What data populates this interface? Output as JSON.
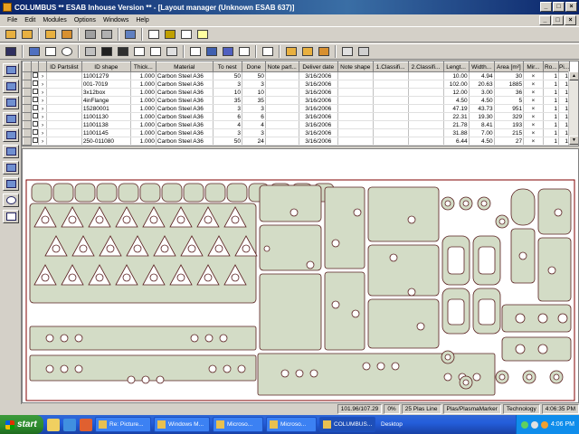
{
  "window": {
    "title": "COLUMBUS ** ESAB Inhouse Version ** - [Layout manager (Unknown ESAB 637)]",
    "min": "_",
    "max": "□",
    "close": "×"
  },
  "menu": [
    "File",
    "Edit",
    "Modules",
    "Options",
    "Windows",
    "Help"
  ],
  "grid": {
    "columns": [
      "ID Partslist",
      "ID shape",
      "Thick...",
      "Material",
      "To nest",
      "Done",
      "Note part...",
      "Deliver date",
      "Note shape",
      "1.Classifi...",
      "2.Classifi...",
      "Lengt...",
      "Width...",
      "Area [m²]",
      "Mir...",
      "Ro...",
      "Pi..."
    ],
    "rows": [
      [
        "11001279",
        "1.000",
        "Carbon Steel A36",
        "50",
        "50",
        "3/16/2006",
        "10.00",
        "4.94",
        "30",
        "×",
        "1",
        "1"
      ],
      [
        "001-7019",
        "1.000",
        "Carbon Steel A36",
        "3",
        "3",
        "3/16/2006",
        "102.00",
        "20.63",
        "1885",
        "×",
        "1",
        "1"
      ],
      [
        "3x12box",
        "1.000",
        "Carbon Steel A36",
        "10",
        "10",
        "3/16/2006",
        "12.00",
        "3.00",
        "36",
        "×",
        "1",
        "1"
      ],
      [
        "4inFlange",
        "1.000",
        "Carbon Steel A36",
        "35",
        "35",
        "3/16/2006",
        "4.50",
        "4.50",
        "5",
        "×",
        "1",
        "1"
      ],
      [
        "15280001",
        "1.000",
        "Carbon Steel A36",
        "3",
        "3",
        "3/16/2006",
        "47.19",
        "43.73",
        "951",
        "×",
        "1",
        "1"
      ],
      [
        "11001130",
        "1.000",
        "Carbon Steel A36",
        "6",
        "6",
        "3/16/2006",
        "22.31",
        "19.30",
        "329",
        "×",
        "1",
        "1"
      ],
      [
        "11001138",
        "1.000",
        "Carbon Steel A36",
        "4",
        "4",
        "3/16/2006",
        "21.78",
        "8.41",
        "193",
        "×",
        "1",
        "1"
      ],
      [
        "11001145",
        "1.000",
        "Carbon Steel A36",
        "3",
        "3",
        "3/16/2006",
        "31.88",
        "7.00",
        "215",
        "×",
        "1",
        "1"
      ],
      [
        "250-011080",
        "1.000",
        "Carbon Steel A36",
        "50",
        "24",
        "3/16/2006",
        "6.44",
        "4.50",
        "27",
        "×",
        "1",
        "1"
      ]
    ]
  },
  "status": {
    "coords": "101.96/107.29",
    "percent": "0%",
    "line": "25 Plas Line",
    "machine": "Plas/PlasmaMarker",
    "tech": "Technology",
    "time": "4:06:35 PM"
  },
  "taskbar": {
    "start": "start",
    "tasks": [
      "Re: Picture...",
      "Windows M...",
      "Microso...",
      "Microso...",
      "COLUMBUS...",
      "Desktop"
    ],
    "clock": "4:06 PM"
  },
  "colors": {
    "part_fill": "#d3dcc6",
    "part_stroke": "#5a2020",
    "sheet_stroke": "#800000"
  }
}
